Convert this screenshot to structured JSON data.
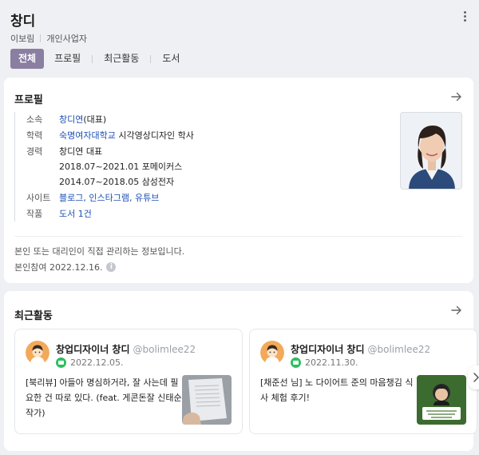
{
  "header": {
    "title": "창디",
    "name": "이보림",
    "occupation": "개인사업자",
    "tabs": [
      "전체",
      "프로필",
      "최근활동",
      "도서"
    ]
  },
  "profile": {
    "section_title": "프로필",
    "rows": [
      {
        "label": "소속",
        "value_link": "창디연",
        "value_rest": "(대표)"
      },
      {
        "label": "학력",
        "value_link": "숙명여자대학교",
        "value_rest": " 시각영상디자인 학사"
      },
      {
        "label": "경력",
        "lines": [
          "창디연 대표",
          "2018.07~2021.01 포메이커스",
          "2014.07~2018.05 삼성전자"
        ]
      },
      {
        "label": "사이트",
        "links": [
          "블로그",
          "인스타그램",
          "유튜브"
        ],
        "sep": ", "
      },
      {
        "label": "작품",
        "value_link": "도서 1건"
      }
    ],
    "note": "본인 또는 대리인이 직접 관리하는 정보입니다.",
    "joined": "본인참여 2022.12.16.",
    "info_icon": "i"
  },
  "activity": {
    "section_title": "최근활동",
    "posts": [
      {
        "author": "창업디자이너 창디",
        "handle": "@bolimlee22",
        "date": "2022.12.05.",
        "text": "[북리뷰] 아들아 명심하거라, 잘 사는데 필요한 건 따로 있다. (feat. 게콘돈잘 신태순 작가)"
      },
      {
        "author": "창업디자이너 창디",
        "handle": "@bolimlee22",
        "date": "2022.11.30.",
        "text": "[채준선 님] 노 다이어트 준의 마음챙김 식사 체험 후기!"
      }
    ]
  },
  "colors": {
    "tab_active": "#8a7ea1",
    "link": "#1d4fb5",
    "blog_green": "#2dbf5f"
  },
  "icons": [
    "more-vertical-icon",
    "arrow-right-icon",
    "info-icon",
    "blog-icon",
    "chevron-right-icon"
  ]
}
